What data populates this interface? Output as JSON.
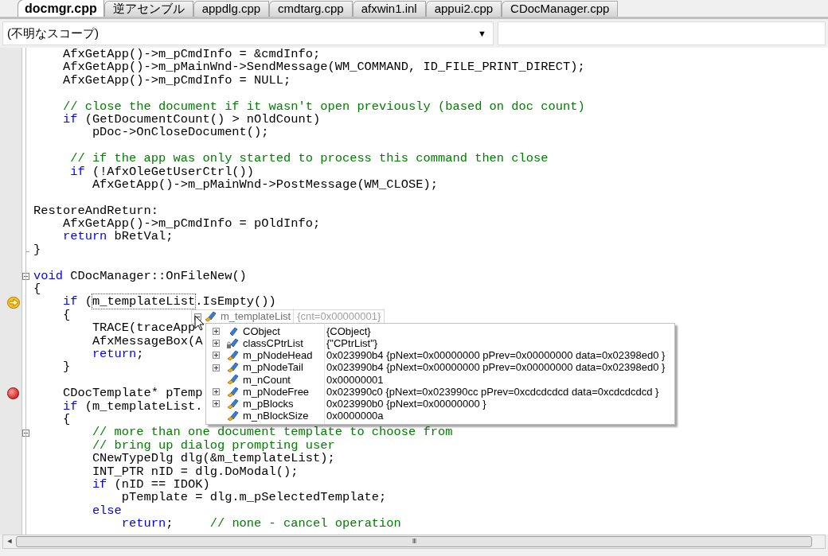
{
  "tabs": [
    {
      "label": "docmgr.cpp",
      "selected": true
    },
    {
      "label": "逆アセンブル",
      "selected": false
    },
    {
      "label": "appdlg.cpp",
      "selected": false
    },
    {
      "label": "cmdtarg.cpp",
      "selected": false
    },
    {
      "label": "afxwin1.inl",
      "selected": false
    },
    {
      "label": "appui2.cpp",
      "selected": false
    },
    {
      "label": "CDocManager.cpp",
      "selected": false
    }
  ],
  "scope_dropdown": {
    "value": "(不明なスコープ)",
    "arrow": "▼"
  },
  "code_lines": [
    {
      "kind": "text",
      "tokens": [
        {
          "kind": "code",
          "t": "    AfxGetApp()->m_pCmdInfo = &cmdInfo;"
        }
      ]
    },
    {
      "kind": "text",
      "tokens": [
        {
          "kind": "code",
          "t": "    AfxGetApp()->m_pMainWnd->SendMessage(WM_COMMAND, ID_FILE_PRINT_DIRECT);"
        }
      ]
    },
    {
      "kind": "text",
      "tokens": [
        {
          "kind": "code",
          "t": "    AfxGetApp()->m_pCmdInfo = NULL;"
        }
      ]
    },
    {
      "kind": "blank"
    },
    {
      "kind": "text",
      "tokens": [
        {
          "kind": "comment",
          "t": "    // close the document if it wasn't open previously (based on doc count)"
        }
      ]
    },
    {
      "kind": "text",
      "tokens": [
        {
          "kind": "keyword",
          "t": "    if"
        },
        {
          "kind": "code",
          "t": " (GetDocumentCount() > nOldCount)"
        }
      ]
    },
    {
      "kind": "text",
      "tokens": [
        {
          "kind": "code",
          "t": "        pDoc->OnCloseDocument();"
        }
      ]
    },
    {
      "kind": "blank"
    },
    {
      "kind": "text",
      "tokens": [
        {
          "kind": "comment",
          "t": "     // if the app was only started to process this command then close"
        }
      ]
    },
    {
      "kind": "text",
      "tokens": [
        {
          "kind": "keyword",
          "t": "     if"
        },
        {
          "kind": "code",
          "t": " (!AfxOleGetUserCtrl())"
        }
      ]
    },
    {
      "kind": "text",
      "tokens": [
        {
          "kind": "code",
          "t": "        AfxGetApp()->m_pMainWnd->PostMessage(WM_CLOSE);"
        }
      ]
    },
    {
      "kind": "blank"
    },
    {
      "kind": "text",
      "tokens": [
        {
          "kind": "code",
          "t": "RestoreAndReturn:"
        }
      ]
    },
    {
      "kind": "text",
      "tokens": [
        {
          "kind": "code",
          "t": "    AfxGetApp()->m_pCmdInfo = pOldInfo;"
        }
      ]
    },
    {
      "kind": "text",
      "tokens": [
        {
          "kind": "keyword",
          "t": "    return"
        },
        {
          "kind": "code",
          "t": " bRetVal;"
        }
      ]
    },
    {
      "kind": "text",
      "tokens": [
        {
          "kind": "code",
          "t": "}"
        }
      ],
      "fold_end": true
    },
    {
      "kind": "blank"
    },
    {
      "kind": "text",
      "tokens": [
        {
          "kind": "keyword",
          "t": "void"
        },
        {
          "kind": "code",
          "t": " CDocManager::OnFileNew()"
        }
      ],
      "fold_start": true
    },
    {
      "kind": "text",
      "tokens": [
        {
          "kind": "code",
          "t": "{"
        }
      ]
    },
    {
      "kind": "text",
      "tokens": [
        {
          "kind": "keyword",
          "t": "    if"
        },
        {
          "kind": "code",
          "t": " ("
        },
        {
          "kind": "hover",
          "t": "m_templateList"
        },
        {
          "kind": "code",
          "t": ".IsEmpty())"
        }
      ],
      "current_statement": true
    },
    {
      "kind": "text",
      "tokens": [
        {
          "kind": "code",
          "t": "    {"
        }
      ]
    },
    {
      "kind": "text",
      "tokens": [
        {
          "kind": "code",
          "t": "        TRACE(traceApp"
        }
      ]
    },
    {
      "kind": "text",
      "tokens": [
        {
          "kind": "code",
          "t": "        AfxMessageBox(A"
        }
      ]
    },
    {
      "kind": "text",
      "tokens": [
        {
          "kind": "keyword",
          "t": "        return"
        },
        {
          "kind": "code",
          "t": ";"
        }
      ]
    },
    {
      "kind": "text",
      "tokens": [
        {
          "kind": "code",
          "t": "    }"
        }
      ]
    },
    {
      "kind": "blank"
    },
    {
      "kind": "text",
      "tokens": [
        {
          "kind": "code",
          "t": "    CDocTemplate* pTemp"
        }
      ],
      "breakpoint": true
    },
    {
      "kind": "text",
      "tokens": [
        {
          "kind": "keyword",
          "t": "    if"
        },
        {
          "kind": "code",
          "t": " (m_templateList."
        }
      ]
    },
    {
      "kind": "text",
      "tokens": [
        {
          "kind": "code",
          "t": "    {"
        }
      ]
    },
    {
      "kind": "text",
      "tokens": [
        {
          "kind": "comment",
          "t": "        // more than one document template to choose from"
        }
      ],
      "fold_start": true
    },
    {
      "kind": "text",
      "tokens": [
        {
          "kind": "comment",
          "t": "        // bring up dialog prompting user"
        }
      ]
    },
    {
      "kind": "text",
      "tokens": [
        {
          "kind": "code",
          "t": "        CNewTypeDlg dlg(&m_templateList);"
        }
      ]
    },
    {
      "kind": "text",
      "tokens": [
        {
          "kind": "code",
          "t": "        INT_PTR nID = dlg.DoModal();"
        }
      ]
    },
    {
      "kind": "text",
      "tokens": [
        {
          "kind": "keyword",
          "t": "        if"
        },
        {
          "kind": "code",
          "t": " (nID == IDOK)"
        }
      ]
    },
    {
      "kind": "text",
      "tokens": [
        {
          "kind": "code",
          "t": "            pTemplate = dlg.m_pSelectedTemplate;"
        }
      ]
    },
    {
      "kind": "text",
      "tokens": [
        {
          "kind": "keyword",
          "t": "        else"
        }
      ]
    },
    {
      "kind": "text",
      "tokens": [
        {
          "kind": "keyword",
          "t": "            return"
        },
        {
          "kind": "code",
          "t": ";     "
        },
        {
          "kind": "comment",
          "t": "// none - cancel operation"
        }
      ]
    }
  ],
  "datatip": {
    "expanded": true,
    "name": "m_templateList",
    "value": "{cnt=0x00000001}",
    "rows": [
      {
        "kind": "base",
        "expandable": true,
        "name": "CObject",
        "value": "{CObject}"
      },
      {
        "kind": "protected",
        "expandable": true,
        "name": "classCPtrList",
        "value": "{\"CPtrList\"}"
      },
      {
        "kind": "member",
        "expandable": true,
        "name": "m_pNodeHead",
        "value": "0x023990b4 {pNext=0x00000000 pPrev=0x00000000 data=0x02398ed0 }"
      },
      {
        "kind": "member",
        "expandable": true,
        "name": "m_pNodeTail",
        "value": "0x023990b4 {pNext=0x00000000 pPrev=0x00000000 data=0x02398ed0 }"
      },
      {
        "kind": "member",
        "expandable": false,
        "name": "m_nCount",
        "value": "0x00000001"
      },
      {
        "kind": "member",
        "expandable": true,
        "name": "m_pNodeFree",
        "value": "0x023990c0 {pNext=0x023990cc pPrev=0xcdcdcdcd data=0xcdcdcdcd }"
      },
      {
        "kind": "member",
        "expandable": true,
        "name": "m_pBlocks",
        "value": "0x023990b0 {pNext=0x00000000 }"
      },
      {
        "kind": "member",
        "expandable": false,
        "name": "m_nBlockSize",
        "value": "0x0000000a"
      }
    ]
  },
  "scrollbar": {
    "left_arrow": "◄",
    "grip": "III"
  }
}
